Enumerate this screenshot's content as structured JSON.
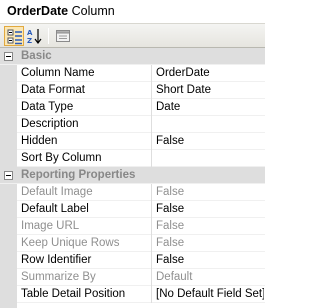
{
  "title": {
    "object": "OrderDate",
    "type": "Column"
  },
  "toolbar": {
    "buttons": [
      {
        "name": "categorized-view",
        "active": true
      },
      {
        "name": "alphabetical-view",
        "active": false
      },
      {
        "name": "property-pages",
        "active": false
      }
    ]
  },
  "categories": [
    {
      "name": "Basic",
      "properties": [
        {
          "label": "Column Name",
          "value": "OrderDate",
          "disabled": false
        },
        {
          "label": "Data Format",
          "value": "Short Date",
          "disabled": false
        },
        {
          "label": "Data Type",
          "value": "Date",
          "disabled": false
        },
        {
          "label": "Description",
          "value": "",
          "disabled": false
        },
        {
          "label": "Hidden",
          "value": "False",
          "disabled": false
        },
        {
          "label": "Sort By Column",
          "value": "",
          "disabled": false
        }
      ]
    },
    {
      "name": "Reporting Properties",
      "properties": [
        {
          "label": "Default Image",
          "value": "False",
          "disabled": true
        },
        {
          "label": "Default Label",
          "value": "False",
          "disabled": false
        },
        {
          "label": "Image URL",
          "value": "False",
          "disabled": true
        },
        {
          "label": "Keep Unique Rows",
          "value": "False",
          "disabled": true
        },
        {
          "label": "Row Identifier",
          "value": "False",
          "disabled": false
        },
        {
          "label": "Summarize By",
          "value": "Default",
          "disabled": true
        },
        {
          "label": "Table Detail Position",
          "value": "[No Default Field Set]",
          "disabled": false
        }
      ]
    }
  ],
  "colors": {
    "category_background": "#dedede",
    "disabled_text": "#8f8f8f",
    "active_button": "#fbe7b5"
  }
}
